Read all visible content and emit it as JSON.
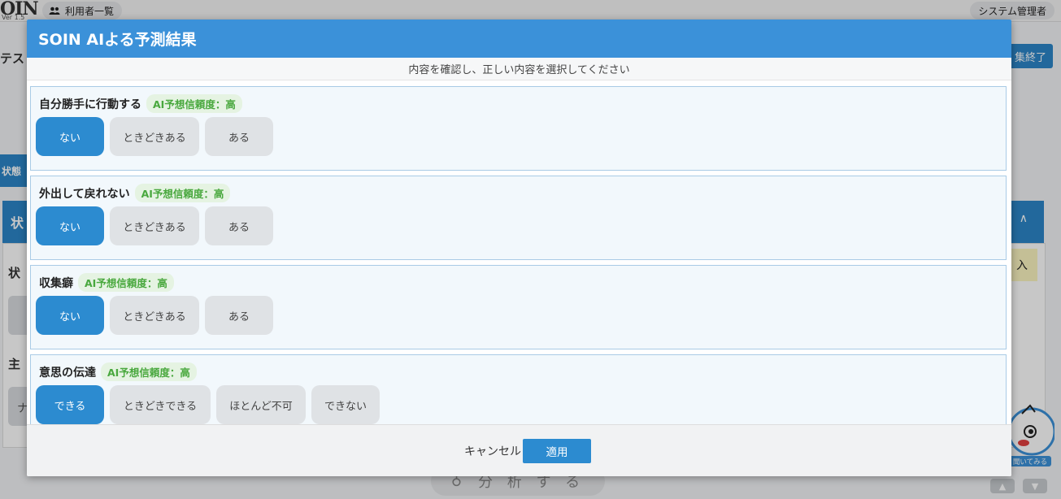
{
  "background": {
    "logo": "OIN",
    "logo_version": "Ver 1.5",
    "nav_user_list": "利用者一覧",
    "admin_label": "システム管理者",
    "left_fragment_1": "テスト",
    "left_tab_fragment": "状態",
    "panel_fragment": "状",
    "left_fragment_2": "状",
    "left_fragment_3": "主",
    "left_fragment_4": "ナ",
    "finish_fragment": "集終了",
    "sticky_fragment": "入",
    "analyze_label": "分 析 す る",
    "mascot_caption": "聞いてみる"
  },
  "modal": {
    "title": "SOIN AIよる予測結果",
    "subtitle": "内容を確認し、正しい内容を選択してください",
    "questions": [
      {
        "title": "自分勝手に行動する",
        "badge": "AI予想信頼度：高",
        "options": [
          "ない",
          "ときどきある",
          "ある"
        ],
        "selected": 0
      },
      {
        "title": "外出して戻れない",
        "badge": "AI予想信頼度：高",
        "options": [
          "ない",
          "ときどきある",
          "ある"
        ],
        "selected": 0
      },
      {
        "title": "収集癖",
        "badge": "AI予想信頼度：高",
        "options": [
          "ない",
          "ときどきある",
          "ある"
        ],
        "selected": 0
      },
      {
        "title": "意思の伝達",
        "badge": "AI予想信頼度：高",
        "options": [
          "できる",
          "ときどきできる",
          "ほとんど不可",
          "できない"
        ],
        "selected": 0
      }
    ],
    "cancel_label": "キャンセル",
    "apply_label": "適用"
  },
  "colors": {
    "header": "#3b91d9",
    "selected_option": "#2c8bd0",
    "badge_text": "#49a83e"
  }
}
